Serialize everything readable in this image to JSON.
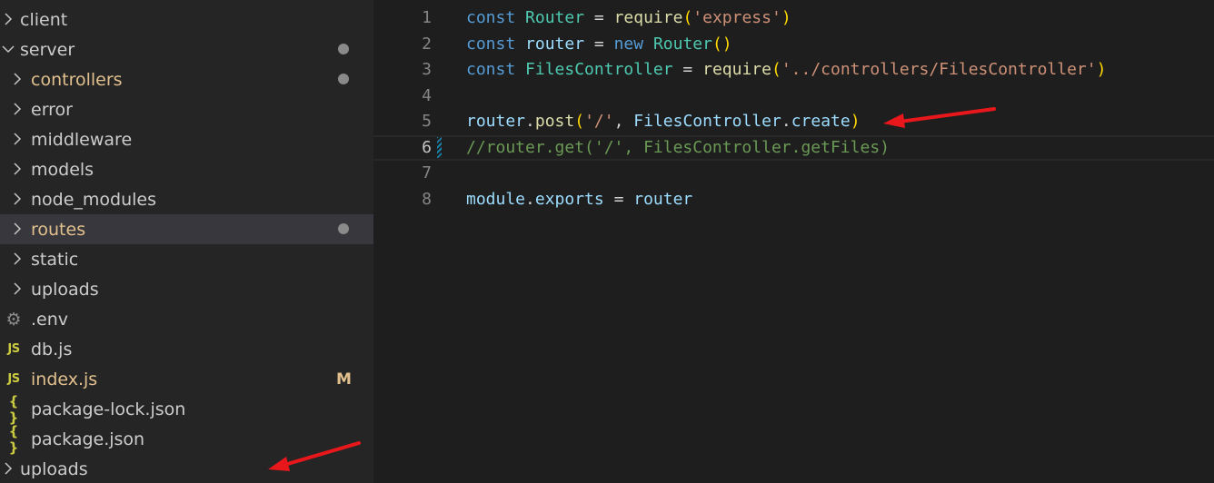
{
  "explorer": {
    "items": [
      {
        "label": "client",
        "type": "folder",
        "indent": 0,
        "expanded": false,
        "modified": false,
        "selected": false
      },
      {
        "label": "server",
        "type": "folder",
        "indent": 0,
        "expanded": true,
        "modified": true,
        "selected": false
      },
      {
        "label": "controllers",
        "type": "folder",
        "indent": 1,
        "expanded": false,
        "modified": true,
        "selected": false
      },
      {
        "label": "error",
        "type": "folder",
        "indent": 1,
        "expanded": false,
        "modified": false,
        "selected": false
      },
      {
        "label": "middleware",
        "type": "folder",
        "indent": 1,
        "expanded": false,
        "modified": false,
        "selected": false
      },
      {
        "label": "models",
        "type": "folder",
        "indent": 1,
        "expanded": false,
        "modified": false,
        "selected": false
      },
      {
        "label": "node_modules",
        "type": "folder",
        "indent": 1,
        "expanded": false,
        "modified": false,
        "selected": false
      },
      {
        "label": "routes",
        "type": "folder",
        "indent": 1,
        "expanded": false,
        "modified": true,
        "selected": true
      },
      {
        "label": "static",
        "type": "folder",
        "indent": 1,
        "expanded": false,
        "modified": false,
        "selected": false
      },
      {
        "label": "uploads",
        "type": "folder",
        "indent": 1,
        "expanded": false,
        "modified": false,
        "selected": false
      },
      {
        "label": ".env",
        "type": "env",
        "indent": 1,
        "modified": false,
        "selected": false
      },
      {
        "label": "db.js",
        "type": "js",
        "indent": 1,
        "modified": false,
        "selected": false
      },
      {
        "label": "index.js",
        "type": "js",
        "indent": 1,
        "modified": true,
        "badge": "M",
        "selected": false
      },
      {
        "label": "package-lock.json",
        "type": "json",
        "indent": 1,
        "modified": false,
        "selected": false
      },
      {
        "label": "package.json",
        "type": "json",
        "indent": 1,
        "modified": false,
        "selected": false
      },
      {
        "label": "uploads",
        "type": "folder",
        "indent": 0,
        "expanded": false,
        "modified": false,
        "selected": false
      }
    ],
    "icons": {
      "js": "JS",
      "json": "{ }",
      "env": "⚙"
    }
  },
  "editor": {
    "current_line": 6,
    "lines": [
      {
        "n": "1",
        "tokens": [
          [
            "kw",
            "const"
          ],
          [
            "plain",
            " "
          ],
          [
            "cls",
            "Router"
          ],
          [
            "plain",
            " = "
          ],
          [
            "fn",
            "require"
          ],
          [
            "brace",
            "("
          ],
          [
            "str",
            "'express'"
          ],
          [
            "brace",
            ")"
          ]
        ]
      },
      {
        "n": "2",
        "tokens": [
          [
            "kw",
            "const"
          ],
          [
            "plain",
            " "
          ],
          [
            "var",
            "router"
          ],
          [
            "plain",
            " = "
          ],
          [
            "kw",
            "new"
          ],
          [
            "plain",
            " "
          ],
          [
            "cls",
            "Router"
          ],
          [
            "brace",
            "()"
          ]
        ]
      },
      {
        "n": "3",
        "tokens": [
          [
            "kw",
            "const"
          ],
          [
            "plain",
            " "
          ],
          [
            "cls",
            "FilesController"
          ],
          [
            "plain",
            " = "
          ],
          [
            "fn",
            "require"
          ],
          [
            "brace",
            "("
          ],
          [
            "str",
            "'../controllers/FilesController'"
          ],
          [
            "brace",
            ")"
          ]
        ]
      },
      {
        "n": "4",
        "tokens": []
      },
      {
        "n": "5",
        "tokens": [
          [
            "var",
            "router"
          ],
          [
            "plain",
            "."
          ],
          [
            "fn",
            "post"
          ],
          [
            "brace",
            "("
          ],
          [
            "str",
            "'/'"
          ],
          [
            "plain",
            ", "
          ],
          [
            "var",
            "FilesController"
          ],
          [
            "plain",
            "."
          ],
          [
            "var",
            "create"
          ],
          [
            "brace",
            ")"
          ]
        ]
      },
      {
        "n": "6",
        "tokens": [
          [
            "cmt",
            "//router.get('/', FilesController.getFiles)"
          ]
        ]
      },
      {
        "n": "7",
        "tokens": []
      },
      {
        "n": "8",
        "tokens": [
          [
            "var",
            "module"
          ],
          [
            "plain",
            "."
          ],
          [
            "var",
            "exports"
          ],
          [
            "plain",
            " = "
          ],
          [
            "var",
            "router"
          ]
        ]
      }
    ]
  },
  "colors": {
    "annotation_arrow": "#e8171b"
  }
}
